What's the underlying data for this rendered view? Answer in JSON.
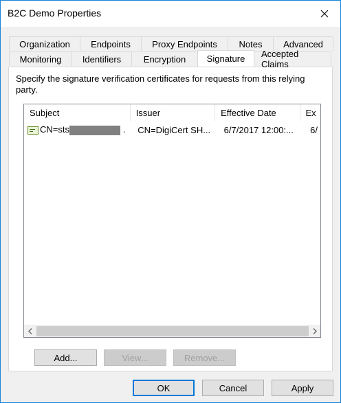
{
  "window": {
    "title": "B2C Demo Properties"
  },
  "tabs": {
    "row1": [
      "Organization",
      "Endpoints",
      "Proxy Endpoints",
      "Notes",
      "Advanced"
    ],
    "row2": [
      "Monitoring",
      "Identifiers",
      "Encryption",
      "Signature",
      "Accepted Claims"
    ],
    "active": "Signature"
  },
  "panel": {
    "description": "Specify the signature verification certificates for requests from this relying party."
  },
  "list": {
    "columns": [
      "Subject",
      "Issuer",
      "Effective Date",
      "Ex"
    ],
    "rows": [
      {
        "subject": "CN=sts",
        "subject_suffix": ".",
        "issuer": "CN=DigiCert SH...",
        "effective": "6/7/2017 12:00:...",
        "expiry": "6/"
      }
    ]
  },
  "buttons": {
    "add": "Add...",
    "view": "View...",
    "remove": "Remove...",
    "ok": "OK",
    "cancel": "Cancel",
    "apply": "Apply"
  }
}
